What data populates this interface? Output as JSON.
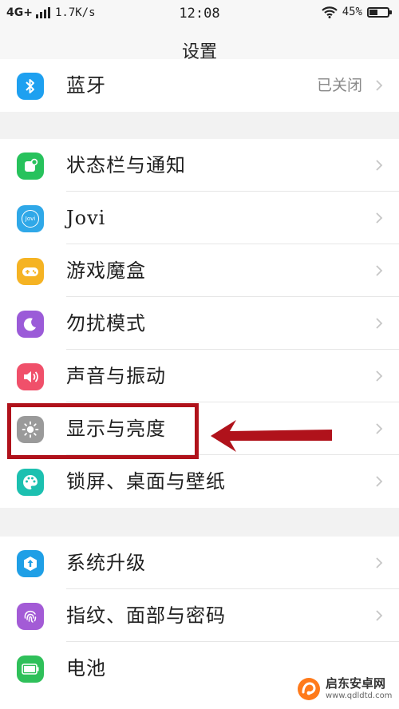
{
  "status_bar": {
    "network": "4G+",
    "speed": "1.7K/s",
    "time": "12:08",
    "battery": "45%",
    "battery_level": 0.45
  },
  "header": {
    "title": "设置"
  },
  "groups": [
    {
      "items": [
        {
          "label": "蓝牙",
          "value": "已关闭",
          "icon": "bluetooth-icon",
          "color": "#1ea0f0"
        }
      ]
    },
    {
      "items": [
        {
          "label": "状态栏与通知",
          "icon": "notification-icon",
          "color": "#27c25c"
        },
        {
          "label": "Jovi",
          "icon": "jovi-icon",
          "color": "#2fa8e8",
          "icon_text": "Jovi"
        },
        {
          "label": "游戏魔盒",
          "icon": "game-controller-icon",
          "color": "#f5b323"
        },
        {
          "label": "勿扰模式",
          "icon": "moon-icon",
          "color": "#9b5bd8"
        },
        {
          "label": "声音与振动",
          "icon": "speaker-icon",
          "color": "#f0506a"
        },
        {
          "label": "显示与亮度",
          "icon": "brightness-icon",
          "color": "#9a9a9a"
        },
        {
          "label": "锁屏、桌面与壁纸",
          "icon": "palette-icon",
          "color": "#1cc0b0"
        }
      ]
    },
    {
      "items": [
        {
          "label": "系统升级",
          "icon": "system-update-icon",
          "color": "#1f9fe6"
        },
        {
          "label": "指纹、面部与密码",
          "icon": "fingerprint-icon",
          "color": "#a35bd6"
        },
        {
          "label": "电池",
          "icon": "battery-icon",
          "color": "#2fc05a"
        }
      ]
    }
  ],
  "watermark": {
    "title": "启东安卓网",
    "url": "www.qdldtd.com"
  },
  "annotation": {
    "color": "#b0121b"
  }
}
